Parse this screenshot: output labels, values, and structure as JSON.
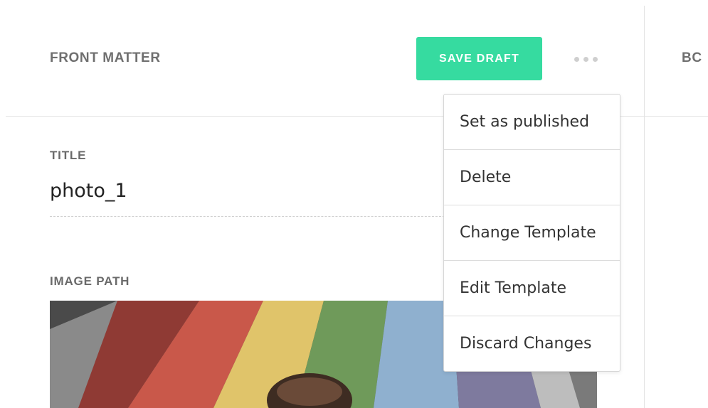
{
  "header": {
    "section_title": "FRONT MATTER",
    "save_label": "SAVE DRAFT",
    "more_icon": "more-horizontal-icon"
  },
  "right_panel": {
    "title_fragment": "BC"
  },
  "fields": {
    "title": {
      "label": "TITLE",
      "value": "photo_1"
    },
    "image_path": {
      "label": "IMAGE PATH"
    }
  },
  "menu": {
    "items": [
      {
        "label": "Set as published"
      },
      {
        "label": "Delete"
      },
      {
        "label": "Change Template"
      },
      {
        "label": "Edit Template"
      },
      {
        "label": "Discard Changes"
      }
    ]
  },
  "colors": {
    "accent": "#36dba0",
    "label": "#6f6f6f",
    "divider": "#e3e3e3"
  }
}
